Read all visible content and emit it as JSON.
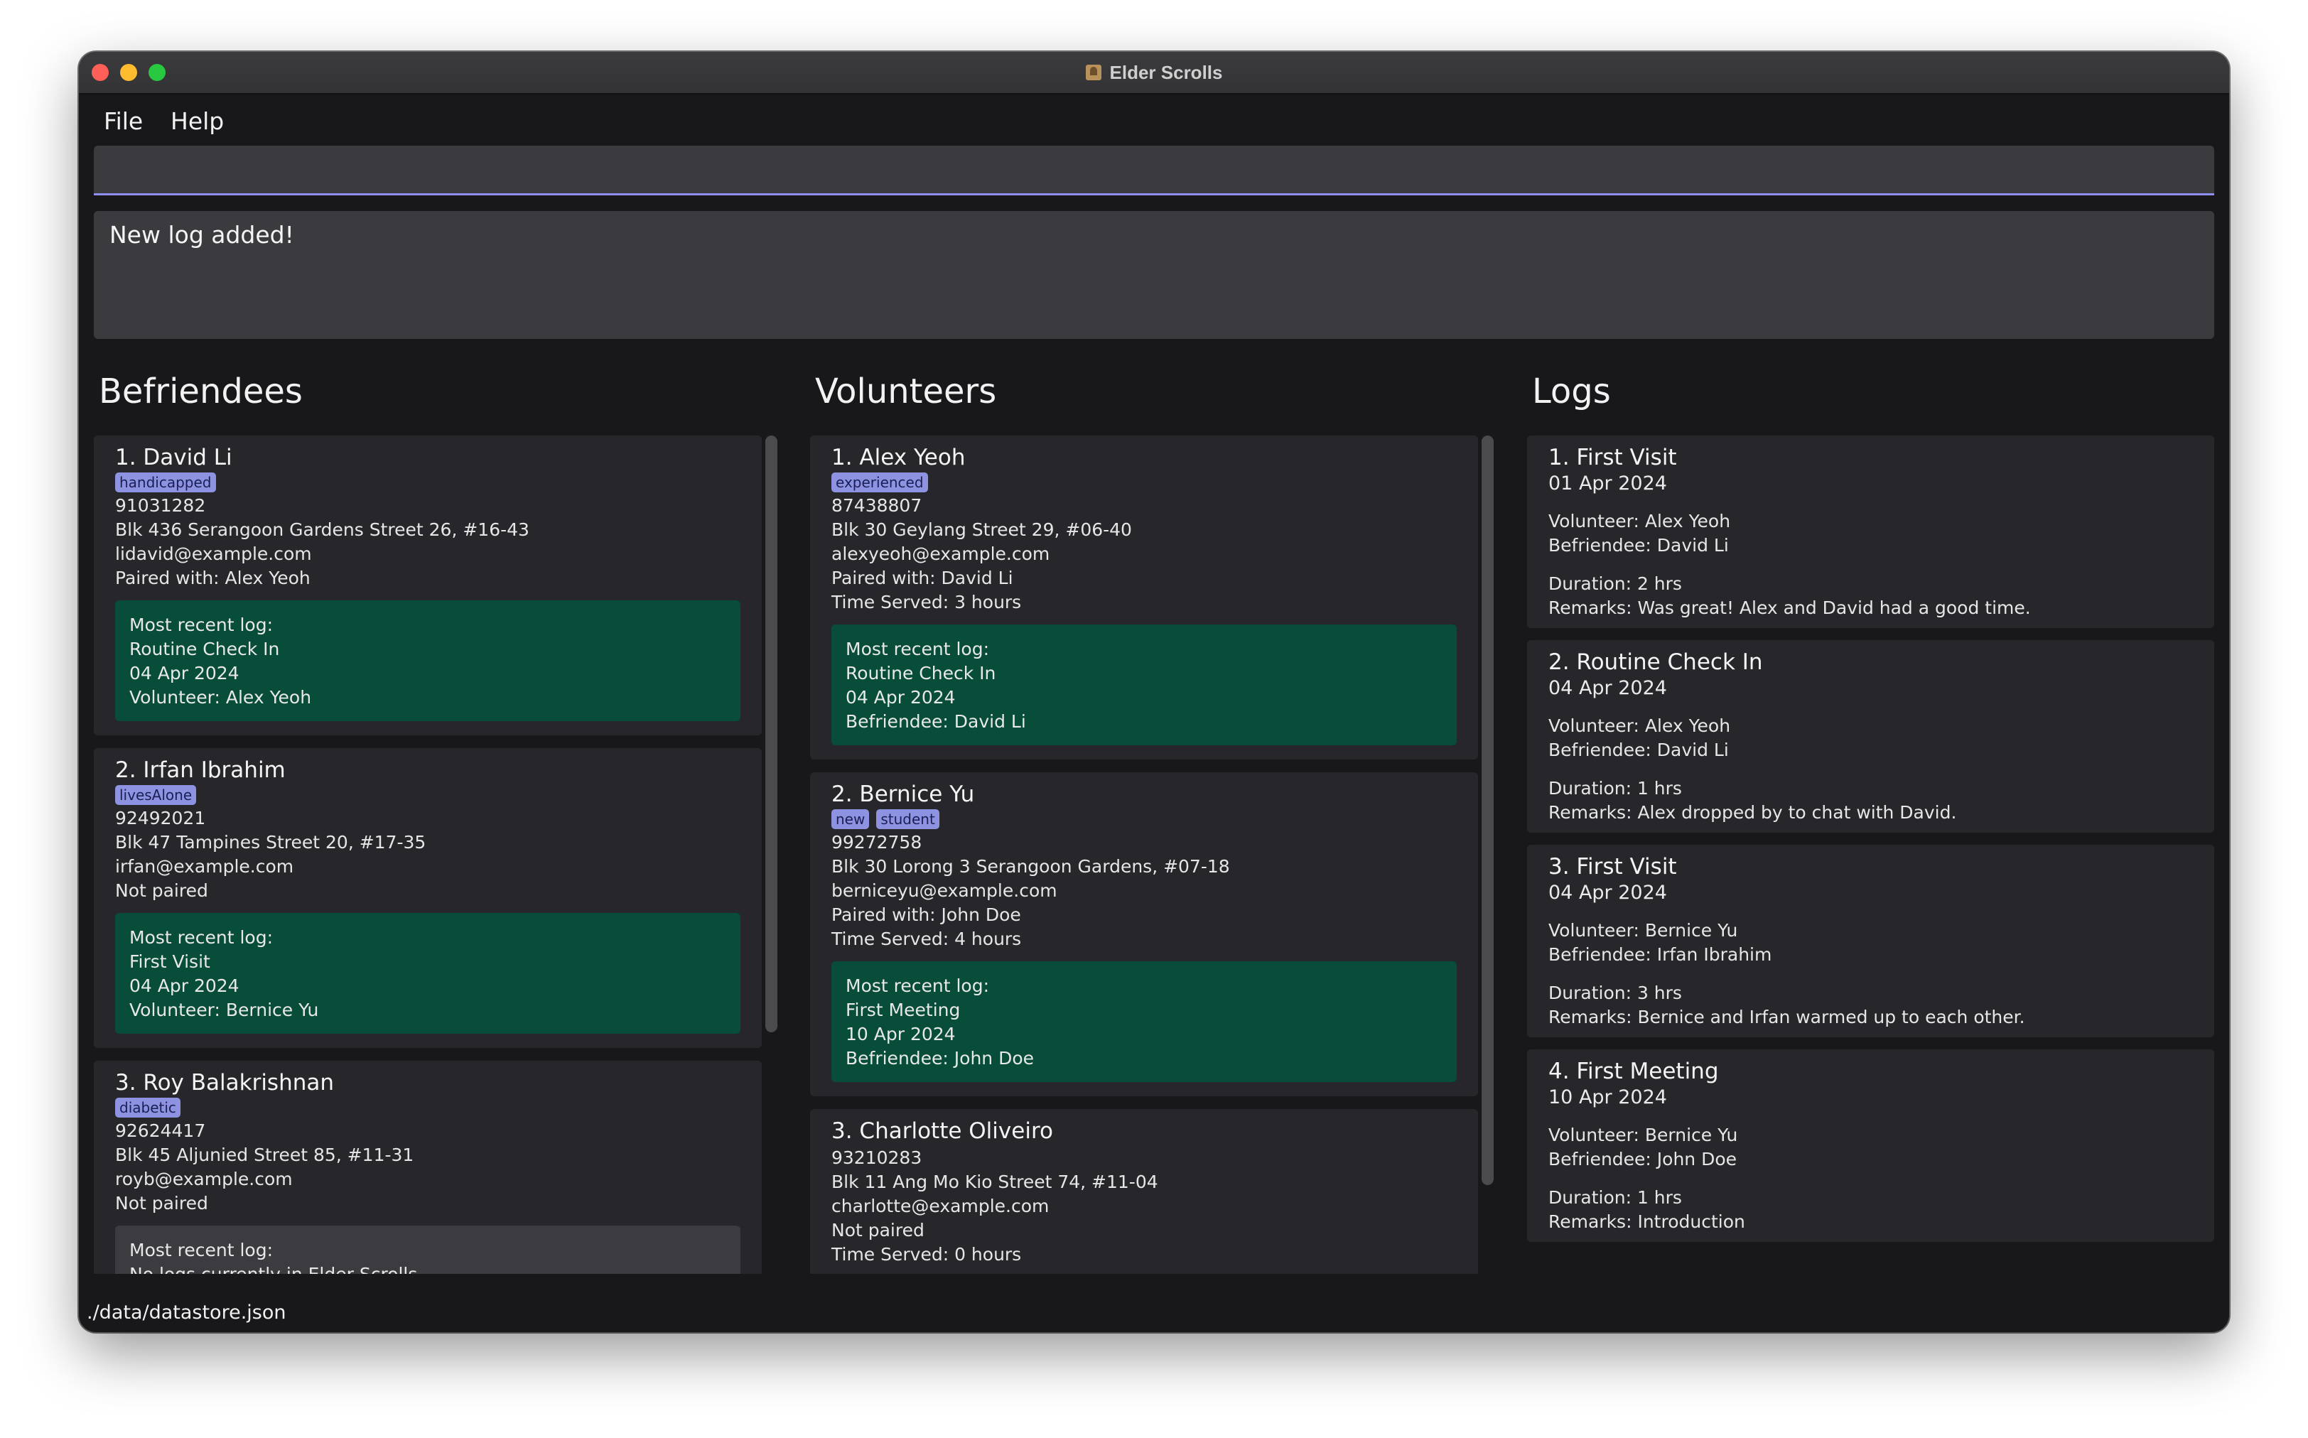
{
  "window": {
    "title": "Elder Scrolls"
  },
  "menu": {
    "file": "File",
    "help": "Help"
  },
  "command": {
    "value": ""
  },
  "result": {
    "text": "New log added!"
  },
  "befriendees": {
    "title": "Befriendees",
    "items": [
      {
        "header": "1.  David Li",
        "tags": [
          "handicapped"
        ],
        "phone": "91031282",
        "address": "Blk 436 Serangoon Gardens Street 26, #16-43",
        "email": "lidavid@example.com",
        "paired": "Paired with: Alex Yeoh",
        "log": {
          "label": "Most recent log:",
          "title": "Routine Check In",
          "date": "04 Apr 2024",
          "with": "Volunteer: Alex Yeoh"
        }
      },
      {
        "header": "2.  Irfan Ibrahim",
        "tags": [
          "livesAlone"
        ],
        "phone": "92492021",
        "address": "Blk 47 Tampines Street 20, #17-35",
        "email": "irfan@example.com",
        "paired": "Not paired",
        "log": {
          "label": "Most recent log:",
          "title": "First Visit",
          "date": "04 Apr 2024",
          "with": "Volunteer: Bernice Yu"
        }
      },
      {
        "header": "3.  Roy Balakrishnan",
        "tags": [
          "diabetic"
        ],
        "phone": "92624417",
        "address": "Blk 45 Aljunied Street 85, #11-31",
        "email": "royb@example.com",
        "paired": "Not paired",
        "log": {
          "label": "Most recent log:",
          "text": "No logs currently in Elder Scrolls"
        }
      }
    ]
  },
  "volunteers": {
    "title": "Volunteers",
    "items": [
      {
        "header": "1.  Alex Yeoh",
        "tags": [
          "experienced"
        ],
        "phone": "87438807",
        "address": "Blk 30 Geylang Street 29, #06-40",
        "email": "alexyeoh@example.com",
        "paired": "Paired with: David Li",
        "time": "Time Served: 3 hours",
        "log": {
          "label": "Most recent log:",
          "title": "Routine Check In",
          "date": "04 Apr 2024",
          "with": "Befriendee: David Li"
        }
      },
      {
        "header": "2.  Bernice Yu",
        "tags": [
          "new",
          "student"
        ],
        "phone": "99272758",
        "address": "Blk 30 Lorong 3 Serangoon Gardens, #07-18",
        "email": "berniceyu@example.com",
        "paired": "Paired with: John Doe",
        "time": "Time Served: 4 hours",
        "log": {
          "label": "Most recent log:",
          "title": "First Meeting",
          "date": "10 Apr 2024",
          "with": "Befriendee: John Doe"
        }
      },
      {
        "header": "3.  Charlotte Oliveiro",
        "tags": [],
        "phone": "93210283",
        "address": "Blk 11 Ang Mo Kio Street 74, #11-04",
        "email": "charlotte@example.com",
        "paired": "Not paired",
        "time": "Time Served: 0 hours"
      }
    ]
  },
  "logs": {
    "title": "Logs",
    "items": [
      {
        "header": "1.  First Visit",
        "date": "01 Apr 2024",
        "volunteer": "Volunteer: Alex Yeoh",
        "befriendee": "Befriendee: David Li",
        "duration": "Duration: 2 hrs",
        "remarks": "Remarks: Was great! Alex and David had a good time."
      },
      {
        "header": "2.  Routine Check In",
        "date": "04 Apr 2024",
        "volunteer": "Volunteer: Alex Yeoh",
        "befriendee": "Befriendee: David Li",
        "duration": "Duration: 1 hrs",
        "remarks": "Remarks: Alex dropped by to chat with David."
      },
      {
        "header": "3.  First Visit",
        "date": "04 Apr 2024",
        "volunteer": "Volunteer: Bernice Yu",
        "befriendee": "Befriendee: Irfan Ibrahim",
        "duration": "Duration: 3 hrs",
        "remarks": "Remarks: Bernice and Irfan warmed up to each other."
      },
      {
        "header": "4.  First Meeting",
        "date": "10 Apr 2024",
        "volunteer": "Volunteer: Bernice Yu",
        "befriendee": "Befriendee: John Doe",
        "duration": "Duration: 1 hrs",
        "remarks": "Remarks: Introduction"
      }
    ]
  },
  "status": {
    "path": "./data/datastore.json"
  }
}
